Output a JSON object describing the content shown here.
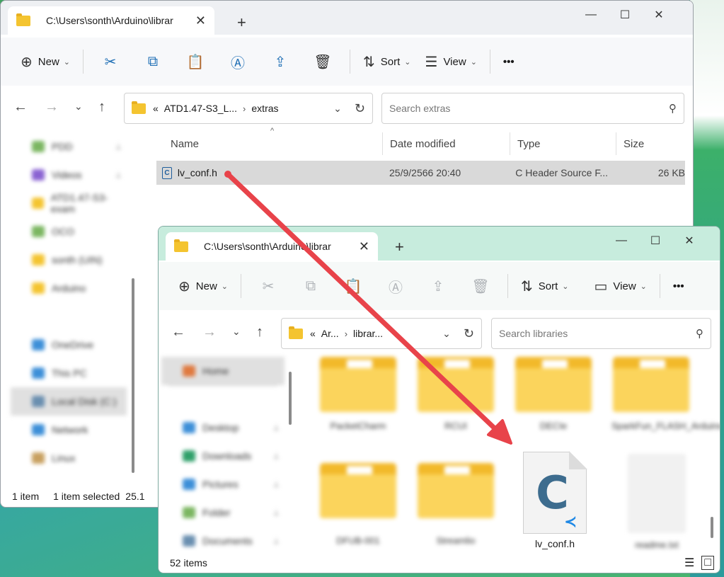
{
  "back_window": {
    "tab_title": "C:\\Users\\sonth\\Arduino\\librar",
    "toolbar": {
      "new_label": "New",
      "sort_label": "Sort",
      "view_label": "View",
      "more_label": "•••"
    },
    "address": {
      "overflow": "«",
      "crumb1": "ATD1.47-S3_L...",
      "crumb2": "extras"
    },
    "search_placeholder": "Search extras",
    "columns": {
      "name": "Name",
      "date": "Date modified",
      "type": "Type",
      "size": "Size"
    },
    "file": {
      "name": "lv_conf.h",
      "date": "25/9/2566 20:40",
      "type": "C Header Source F...",
      "size": "26 KB"
    },
    "sidebar_items": [
      "PDD",
      "Videos",
      "ATD1.47-S3-exam",
      "OCO",
      "sonth (UIN)",
      "Arduino",
      "OneDrive",
      "This PC",
      "Local Disk (C:)",
      "Network",
      "Linux"
    ],
    "status": {
      "count": "1 item",
      "selected": "1 item selected",
      "size": "25.1"
    }
  },
  "front_window": {
    "tab_title": "C:\\Users\\sonth\\Arduino\\librar",
    "toolbar": {
      "new_label": "New",
      "sort_label": "Sort",
      "view_label": "View",
      "more_label": "•••"
    },
    "address": {
      "overflow": "«",
      "crumb1": "Ar...",
      "crumb2": "librar..."
    },
    "search_placeholder": "Search libraries",
    "sidebar_items": [
      "Home",
      "Desktop",
      "Downloads",
      "Pictures",
      "Folder",
      "Documents"
    ],
    "folders": [
      "PacketCharm",
      "RCUI",
      "DECIe",
      "SparkFun_FLASH_Arduino_Library",
      "DFUB-001",
      "Streamlio"
    ],
    "dropped_file": "lv_conf.h",
    "blank_file": "readme.txt",
    "status": {
      "count": "52 items"
    }
  },
  "colors": {
    "arrow": "#e8434a",
    "folder": "#f4c430",
    "accent": "#1f6fb5"
  }
}
